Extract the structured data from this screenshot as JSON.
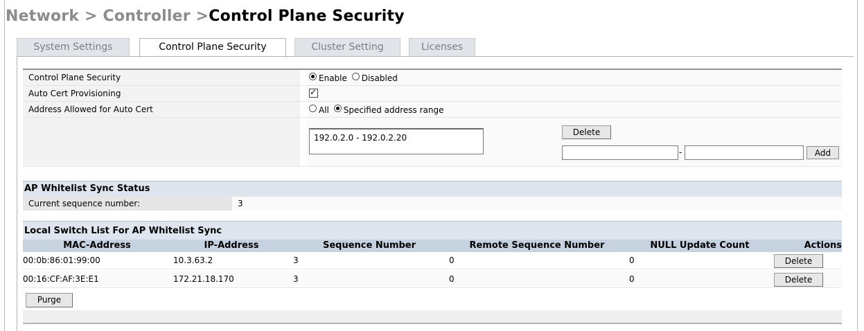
{
  "breadcrumb": {
    "part1": "Network > ",
    "part2": "Controller >",
    "current": "Control Plane Security"
  },
  "tabs": [
    {
      "label": "System Settings"
    },
    {
      "label": "Control Plane Security"
    },
    {
      "label": "Cluster Setting"
    },
    {
      "label": "Licenses"
    }
  ],
  "settings": {
    "cps_label": "Control Plane Security",
    "cps_enable": "Enable",
    "cps_disable": "Disabled",
    "auto_cert_label": "Auto Cert Provisioning",
    "addr_label": "Address Allowed for Auto Cert",
    "addr_all": "All",
    "addr_specified": "Specified address range",
    "range_value": "192.0.2.0 - 192.0.2.20",
    "delete_label": "Delete",
    "range_separator": "-",
    "add_label": "Add",
    "cps_selected": "Enable",
    "auto_cert_checked": true,
    "addr_selected": "Specified address range"
  },
  "whitelist_status": {
    "title": "AP Whitelist Sync Status",
    "seq_label": "Current sequence number:",
    "seq_value": "3"
  },
  "switch_list": {
    "title": "Local Switch List For AP Whitelist Sync",
    "columns": [
      "MAC-Address",
      "IP-Address",
      "Sequence Number",
      "Remote Sequence Number",
      "NULL Update Count",
      "Actions"
    ],
    "rows": [
      {
        "mac": "00:0b:86:01:99:00",
        "ip": "10.3.63.2",
        "seq": "3",
        "remote_seq": "0",
        "null_count": "0",
        "action": "Delete"
      },
      {
        "mac": "00:16:CF:AF:3E:E1",
        "ip": "172.21.18.170",
        "seq": "3",
        "remote_seq": "0",
        "null_count": "0",
        "action": "Delete"
      }
    ],
    "purge_label": "Purge"
  }
}
